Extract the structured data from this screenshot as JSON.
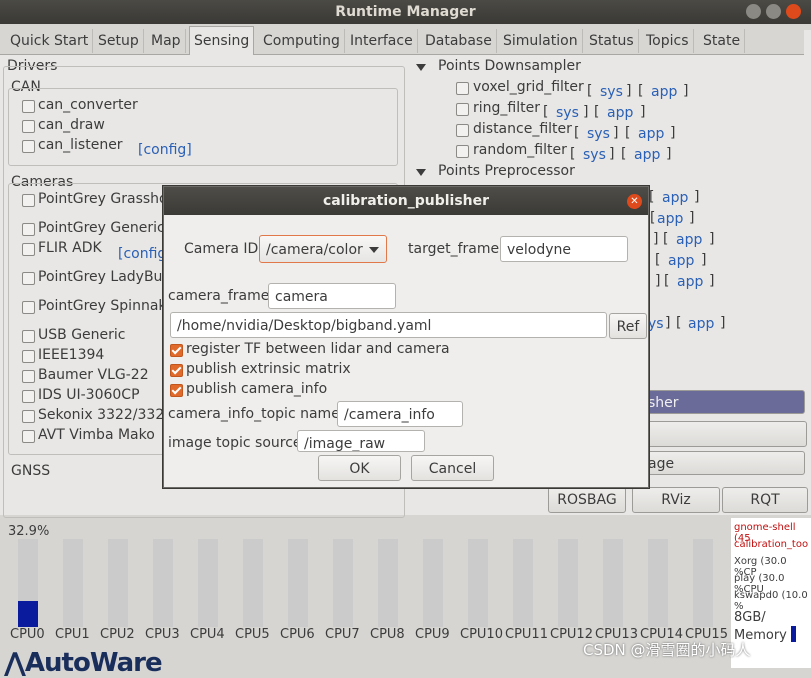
{
  "window": {
    "title": "Runtime Manager"
  },
  "tabs": [
    {
      "label": "Quick Start"
    },
    {
      "label": "Setup"
    },
    {
      "label": "Map"
    },
    {
      "label": "Sensing"
    },
    {
      "label": "Computing"
    },
    {
      "label": "Interface"
    },
    {
      "label": "Database"
    },
    {
      "label": "Simulation"
    },
    {
      "label": "Status"
    },
    {
      "label": "Topics"
    },
    {
      "label": "State"
    }
  ],
  "drivers": {
    "title": "Drivers",
    "can": {
      "title": "CAN",
      "items": [
        {
          "label": "can_converter"
        },
        {
          "label": "can_draw"
        },
        {
          "label": "can_listener",
          "link": "[config]"
        }
      ]
    },
    "cameras": {
      "title": "Cameras",
      "items": [
        {
          "label": "PointGrey Grassho"
        },
        {
          "label": "PointGrey Generic"
        },
        {
          "label": "FLIR ADK",
          "link": "[config"
        },
        {
          "label": "PointGrey LadyBug"
        },
        {
          "label": "PointGrey Spinnake"
        },
        {
          "label": "USB Generic"
        },
        {
          "label": "IEEE1394"
        },
        {
          "label": "Baumer VLG-22"
        },
        {
          "label": "IDS UI-3060CP"
        },
        {
          "label": "Sekonix 3322/3323"
        },
        {
          "label": "AVT Vimba Mako"
        }
      ]
    },
    "gnss_title": "GNSS"
  },
  "points_downsampler": {
    "title": "Points Downsampler",
    "items": [
      {
        "label": "voxel_grid_filter"
      },
      {
        "label": "ring_filter"
      },
      {
        "label": "distance_filter"
      },
      {
        "label": "random_filter"
      }
    ],
    "sys": "sys",
    "app": "app",
    "lb": "[",
    "rb": "]"
  },
  "points_preprocessor": {
    "title": "Points Preprocessor"
  },
  "partial_links": {
    "app": "app",
    "ys": "ys",
    "lb": "[",
    "rb": "]"
  },
  "right_buttons": {
    "sher": "sher",
    "age": "age"
  },
  "toolbar": {
    "rosbag": "ROSBAG",
    "rviz": "RViz",
    "rqt": "RQT"
  },
  "cpu": {
    "percent": "32.9%",
    "labels": [
      "CPU0",
      "CPU1",
      "CPU2",
      "CPU3",
      "CPU4",
      "CPU5",
      "CPU6",
      "CPU7",
      "CPU8",
      "CPU9",
      "CPU10",
      "CPU11",
      "CPU12",
      "CPU13",
      "CPU14",
      "CPU15"
    ],
    "usage": [
      0.329,
      0,
      0,
      0,
      0,
      0,
      0,
      0,
      0,
      0,
      0,
      0,
      0,
      0,
      0,
      0
    ]
  },
  "processes": [
    {
      "text": "gnome-shell (45",
      "color": "#c01010"
    },
    {
      "text": "calibration_too",
      "color": "#c01010"
    },
    {
      "text": "Xorg (30.0 %CP",
      "color": "#3c3c3c"
    },
    {
      "text": "play (30.0 %CPU",
      "color": "#3c3c3c"
    },
    {
      "text": "kswapd0 (10.0 %",
      "color": "#3c3c3c"
    }
  ],
  "memory": {
    "value": "8GB/",
    "label": "Memory"
  },
  "logo": {
    "text": "AutoWare"
  },
  "watermark": {
    "text": "CSDN @滑雪圈的小码人"
  },
  "dialog": {
    "title": "calibration_publisher",
    "camera_id_label": "Camera ID",
    "camera_id_value": "/camera/color",
    "target_frame_label": "target_frame",
    "target_frame_value": "velodyne",
    "camera_frame_label": "camera_frame",
    "camera_frame_value": "camera",
    "yaml_path": "/home/nvidia/Desktop/bigband.yaml",
    "ref_label": "Ref",
    "opt_register": "register TF between lidar and camera",
    "opt_extrinsic": "publish extrinsic matrix",
    "opt_camera_info": "publish camera_info",
    "camera_info_topic_label": "camera_info_topic name",
    "camera_info_topic_value": "/camera_info",
    "image_topic_label": "image topic source",
    "image_topic_value": "/image_raw",
    "ok": "OK",
    "cancel": "Cancel"
  }
}
